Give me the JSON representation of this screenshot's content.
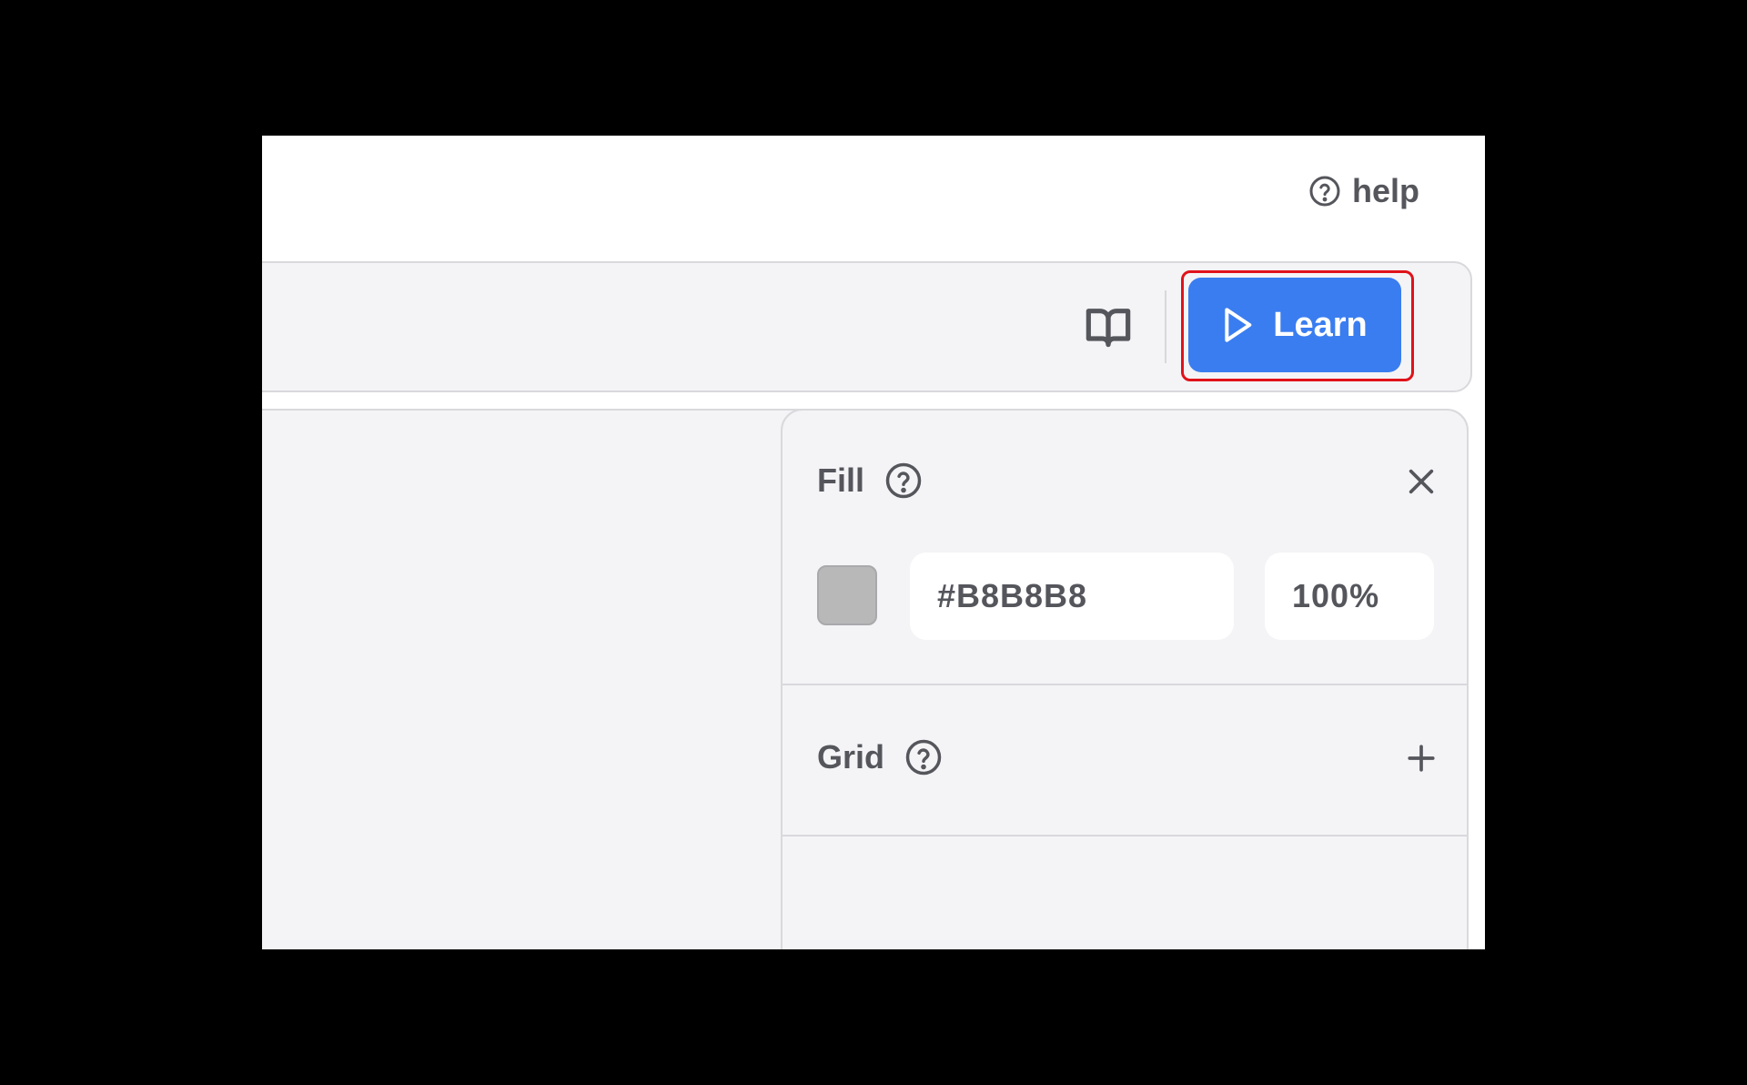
{
  "header": {
    "help_label": "help",
    "help_icon": "question-circle-icon"
  },
  "toolbar": {
    "book_icon": "book-open-icon",
    "learn_label": "Learn",
    "learn_icon": "play-icon",
    "learn_color": "#3A7DF0",
    "highlight_color": "#E0121B"
  },
  "fill": {
    "title": "Fill",
    "help_icon": "question-circle-icon",
    "close_icon": "close-icon",
    "swatch_color": "#B8B8B8",
    "hex_value": "#B8B8B8",
    "opacity_value": "100%"
  },
  "grid": {
    "title": "Grid",
    "help_icon": "question-circle-icon",
    "add_icon": "plus-icon"
  }
}
